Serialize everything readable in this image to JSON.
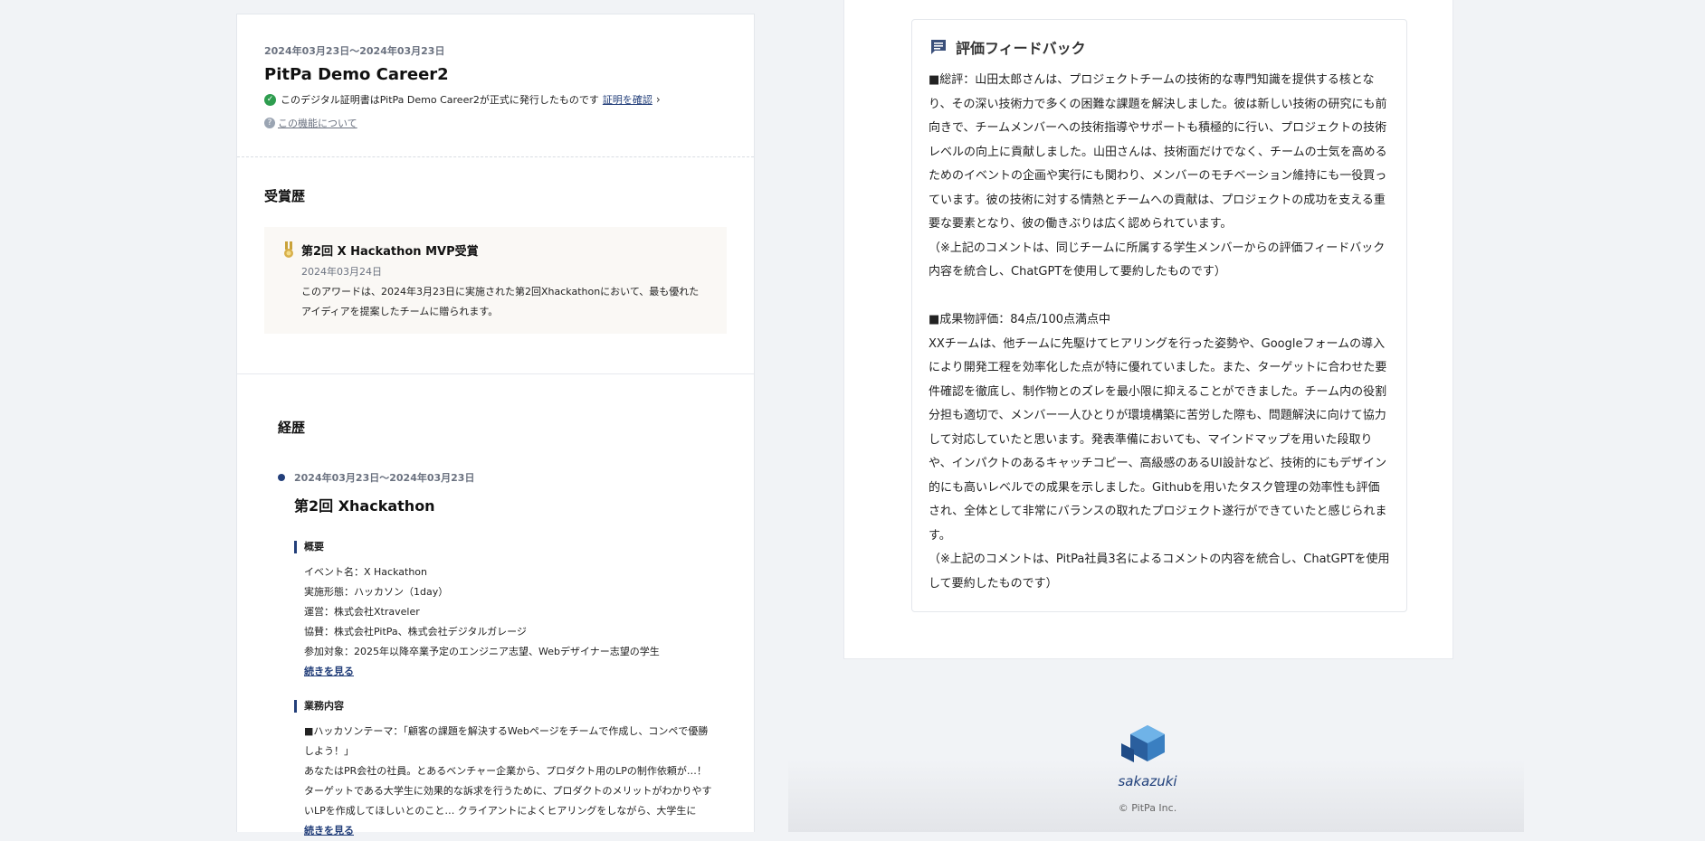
{
  "certificate": {
    "date": "2024年03月23日〜2024年03月23日",
    "title": "PitPa Demo Career2",
    "verify_text": "このデジタル証明書はPitPa Demo Career2が正式に発行したものです",
    "verify_link": "証明を確認",
    "about_link": "この機能について"
  },
  "awards": {
    "heading": "受賞歴",
    "items": [
      {
        "title": "第2回 X Hackathon MVP受賞",
        "date": "2024年03月24日",
        "description": "このアワードは、2024年3月23日に実施された第2回Xhackathonにおいて、最も優れたアイディアを提案したチームに贈られます。"
      }
    ]
  },
  "career": {
    "heading": "経歴",
    "date": "2024年03月23日〜2024年03月23日",
    "title": "第2回 Xhackathon",
    "overview_heading": "概要",
    "overview_items": [
      "イベント名：X Hackathon",
      "実施形態：ハッカソン（1day）",
      "運営：株式会社Xtraveler",
      "協賛：株式会社PitPa、株式会社デジタルガレージ",
      "参加対象：2025年以降卒業予定のエンジニア志望、Webデザイナー志望の学生"
    ],
    "more_label": "続きを見る",
    "work_heading": "業務内容",
    "work_text": "■ハッカソンテーマ：「顧客の課題を解決するWebページをチームで作成し、コンペで優勝しよう！」",
    "work_text2": "あなたはPR会社の社員。とあるベンチャー企業から、プロダクト用のLPの制作依頼が…！ターゲットである大学生に効果的な訴求を行うために、プロダクトのメリットがわかりやすいLPを作成してほしいとのこと… クライアントによくヒアリングをしながら、大学生に",
    "more_label2": "続きを見る"
  },
  "feedback": {
    "title": "評価フィードバック",
    "p1": "■総評：山田太郎さんは、プロジェクトチームの技術的な専門知識を提供する核となり、その深い技術力で多くの困難な課題を解決しました。彼は新しい技術の研究にも前向きで、チームメンバーへの技術指導やサポートも積極的に行い、プロジェクトの技術レベルの向上に貢献しました。山田さんは、技術面だけでなく、チームの士気を高めるためのイベントの企画や実行にも関わり、メンバーのモチベーション維持にも一役買っています。彼の技術に対する情熱とチームへの貢献は、プロジェクトの成功を支える重要な要素となり、彼の働きぶりは広く認められています。",
    "p2": "（※上記のコメントは、同じチームに所属する学生メンバーからの評価フィードバック内容を統合し、ChatGPTを使用して要約したものです）",
    "p3": "■成果物評価：84点/100点満点中",
    "p4": "XXチームは、他チームに先駆けてヒアリングを行った姿勢や、Googleフォームの導入により開発工程を効率化した点が特に優れていました。また、ターゲットに合わせた要件確認を徹底し、制作物とのズレを最小限に抑えることができました。チーム内の役割分担も適切で、メンバー一人ひとりが環境構築に苦労した際も、問題解決に向けて協力して対応していたと思います。発表準備においても、マインドマップを用いた段取りや、インパクトのあるキャッチコピー、高級感のあるUI設計など、技術的にもデザイン的にも高いレベルでの成果を示しました。Githubを用いたタスク管理の効率性も評価され、全体として非常にバランスの取れたプロジェクト遂行ができていたと感じられます。",
    "p5": "（※上記のコメントは、PitPa社員3名によるコメントの内容を統合し、ChatGPTを使用して要約したものです）"
  },
  "footer": {
    "logo_text": "sakazuki",
    "copyright": "© PitPa Inc."
  },
  "colors": {
    "accent": "#233f7a",
    "verified": "#2e9d4f",
    "logo_blue": "#3a7fc1"
  }
}
